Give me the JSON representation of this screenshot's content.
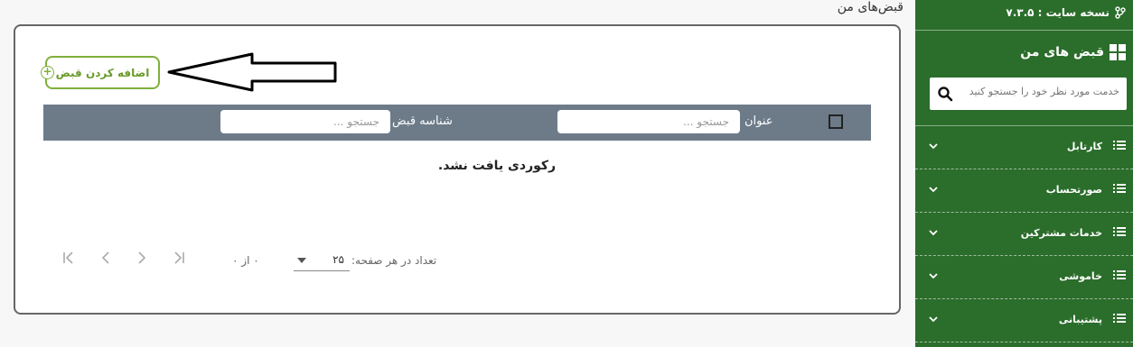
{
  "main": {
    "heading": "قبض‌های من",
    "add_button_label": "اضافه کردن قبض",
    "filters": {
      "title_label": "عنوان",
      "title_placeholder": "جستجو ...",
      "receipt_label": "شناسه قبض",
      "receipt_placeholder": "جستجو ..."
    },
    "empty_message": "رکوردی یافت نشد.",
    "pagination": {
      "per_page_label": "تعداد در هر صفحه:",
      "per_page_value": "۲۵",
      "range": "۰ از ۰"
    }
  },
  "sidebar": {
    "version": "نسخه سایت : ۷.۳.۵",
    "title": "قبض های من",
    "search_placeholder": "خدمت مورد نظر خود را جستجو کنید",
    "menu": [
      {
        "label": "کارتابل"
      },
      {
        "label": "صورتحساب"
      },
      {
        "label": "خدمات مشترکین"
      },
      {
        "label": "خاموشی"
      },
      {
        "label": "پشتیبانی"
      }
    ]
  },
  "colors": {
    "sidebar_bg": "#2b6d2b",
    "accent_green": "#7fb03b",
    "filter_bar": "#6d7b89"
  },
  "icons": [
    "branch-icon",
    "grid-icon",
    "search-icon",
    "list-icon",
    "chevron-down-icon",
    "plus-circle-icon",
    "arrow-left-icon",
    "first-page-icon",
    "prev-page-icon",
    "next-page-icon",
    "last-page-icon",
    "checkbox-icon",
    "caret-down-icon"
  ]
}
